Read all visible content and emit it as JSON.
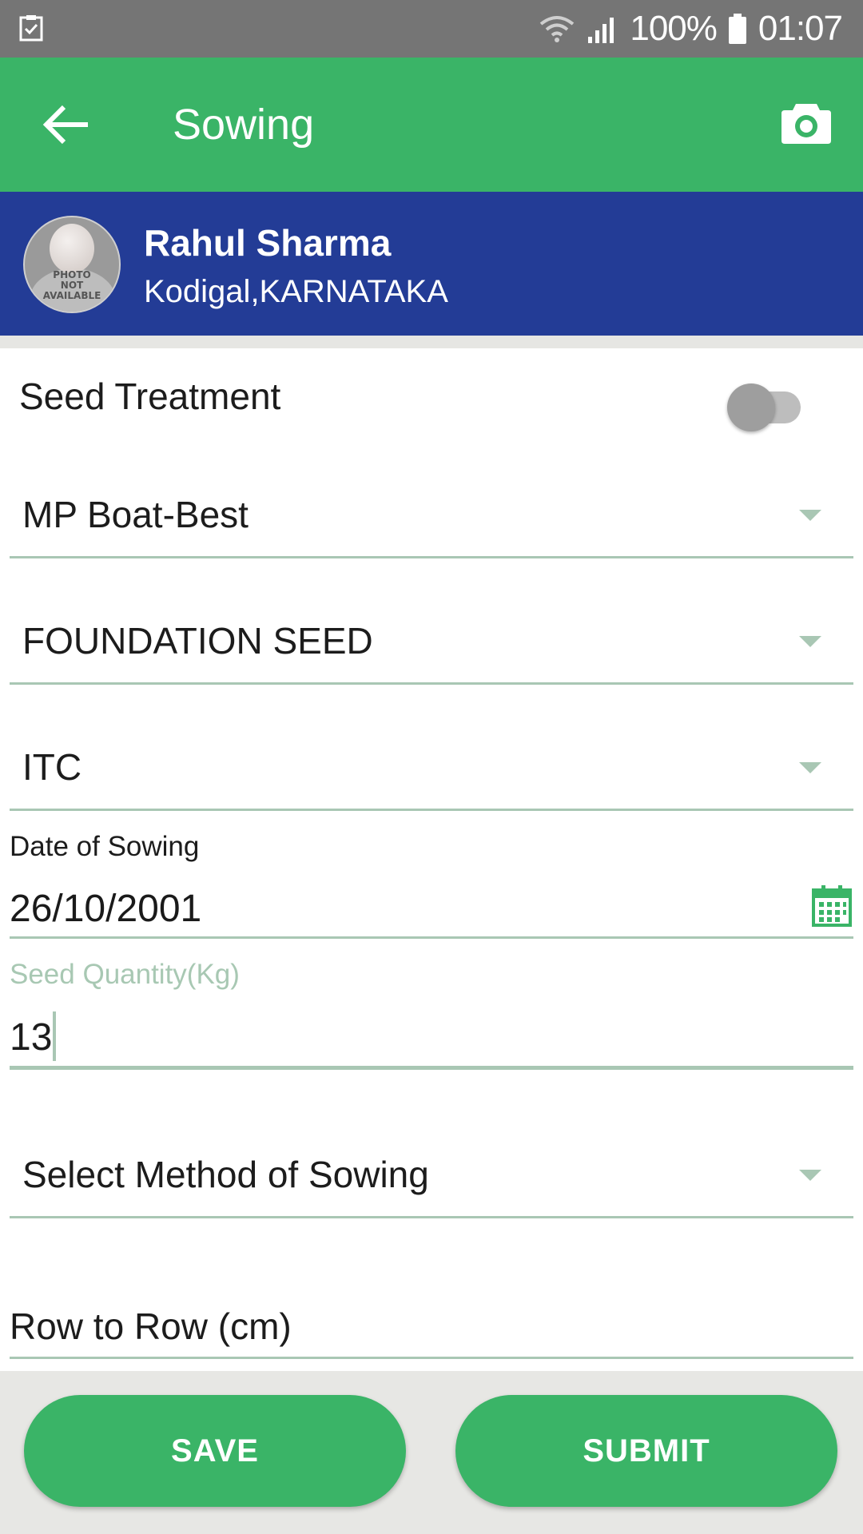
{
  "status_bar": {
    "battery": "100%",
    "time": "01:07",
    "icons": [
      "checklist-icon",
      "wifi-icon",
      "signal-icon",
      "battery-icon"
    ]
  },
  "app_bar": {
    "title": "Sowing",
    "back_icon": "arrow-left-icon",
    "camera_icon": "camera-icon",
    "color": "#3ab467"
  },
  "profile": {
    "name": "Rahul Sharma",
    "location": "Kodigal,KARNATAKA",
    "avatar_text": [
      "PHOTO",
      "NOT",
      "AVAILABLE"
    ],
    "color": "#233c96"
  },
  "form": {
    "seed_treatment_label": "Seed Treatment",
    "seed_treatment_on": false,
    "variety": "MP Boat-Best",
    "seed_class": "FOUNDATION SEED",
    "seed_source": "ITC",
    "date_label": "Date of Sowing",
    "date_value": "26/10/2001",
    "seed_qty_label": "Seed Quantity(Kg)",
    "seed_qty_value": "13",
    "method_placeholder": "Select Method of Sowing",
    "row_to_row_label": "Row to Row (cm)"
  },
  "actions": {
    "save_label": "SAVE",
    "submit_label": "SUBMIT"
  }
}
